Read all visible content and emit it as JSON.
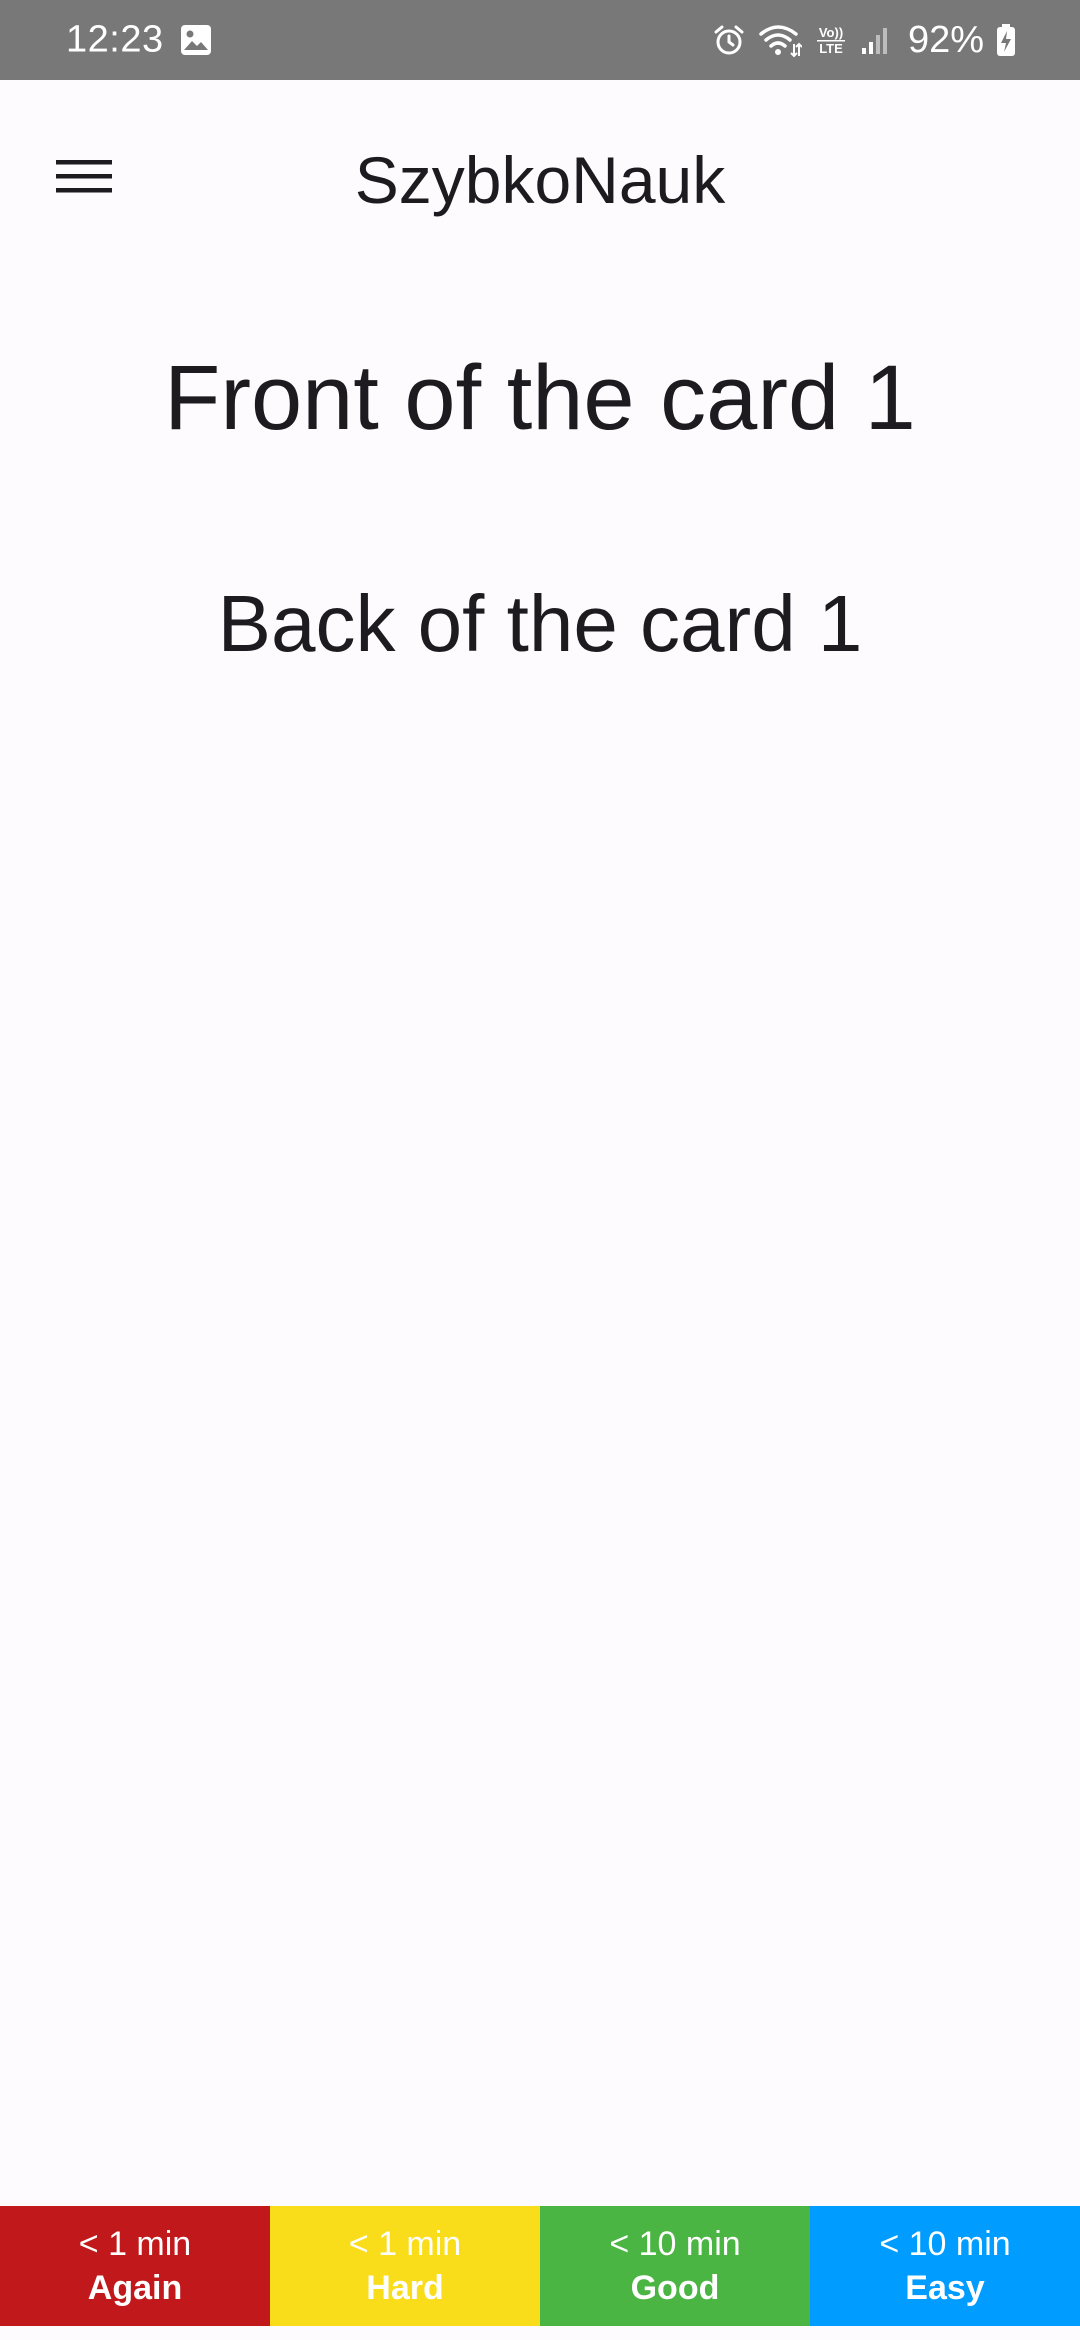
{
  "status_bar": {
    "time": "12:23",
    "left_icons": [
      "image-icon"
    ],
    "right_icons": [
      "alarm-icon",
      "wifi-icon",
      "volte-icon",
      "signal-icon"
    ],
    "volte_text": "Vo)) LTE",
    "battery_percent": "92%",
    "battery_icon": "battery-charging-icon",
    "background_color": "#787878"
  },
  "app_bar": {
    "menu_icon": "hamburger-menu-icon",
    "title": "SzybkoNauk"
  },
  "card": {
    "front": "Front of the card 1",
    "back": "Back of the card 1"
  },
  "answers": [
    {
      "time": "< 1 min",
      "label": "Again",
      "color": "#c1191b"
    },
    {
      "time": "< 1 min",
      "label": "Hard",
      "color": "#f9dc1a"
    },
    {
      "time": "< 10 min",
      "label": "Good",
      "color": "#4bb543"
    },
    {
      "time": "< 10 min",
      "label": "Easy",
      "color": "#009cff"
    }
  ]
}
